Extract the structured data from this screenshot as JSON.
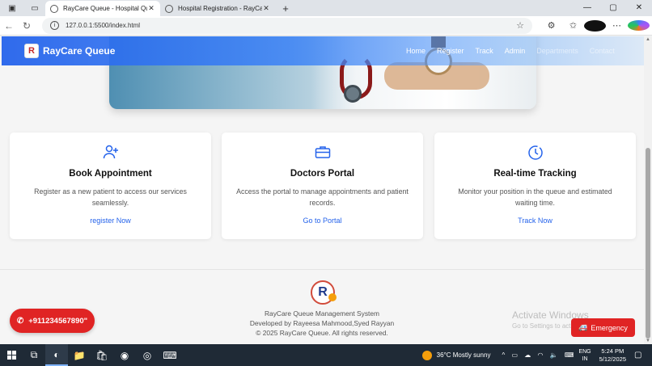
{
  "browser": {
    "tabs": [
      {
        "title": "RayCare Queue - Hospital Queue",
        "active": true
      },
      {
        "title": "Hospital Registration - RayCare Queue",
        "active": false
      }
    ],
    "new_tab": "+",
    "url": "127.0.0.1:5500/index.html",
    "window_controls": {
      "minimize": "—",
      "maximize": "▢",
      "close": "✕"
    }
  },
  "navbar": {
    "brand": "RayCare Queue",
    "logo_letter": "R",
    "links": [
      "Home",
      "Register",
      "Track",
      "Admin",
      "Departments",
      "Contact"
    ]
  },
  "cards": [
    {
      "icon": "user-plus-icon",
      "title": "Book Appointment",
      "text": "Register as a new patient to access our services seamlessly.",
      "link": "register Now"
    },
    {
      "icon": "briefcase-icon",
      "title": "Doctors Portal",
      "text": "Access the portal to manage appointments and patient records.",
      "link": "Go to Portal"
    },
    {
      "icon": "clock-icon",
      "title": "Real-time Tracking",
      "text": "Monitor your position in the queue and estimated waiting time.",
      "link": "Track Now"
    }
  ],
  "footer": {
    "line1": "RayCare Queue Management System",
    "line2": "Developed by Rayeesa Mahmood,Syed Rayyan",
    "line3": "© 2025 RayCare Queue. All rights reserved.",
    "logo_letter": "R"
  },
  "floating": {
    "phone": "+911234567890\"",
    "emergency": "Emergency"
  },
  "watermark": {
    "title": "Activate Windows",
    "subtitle": "Go to Settings to activate Windows."
  },
  "taskbar": {
    "weather": "36°C  Mostly sunny",
    "lang_top": "ENG",
    "lang_bottom": "IN",
    "time": "5:24 PM",
    "date": "5/12/2025"
  },
  "colors": {
    "accent": "#2563eb",
    "danger": "#e02424"
  }
}
